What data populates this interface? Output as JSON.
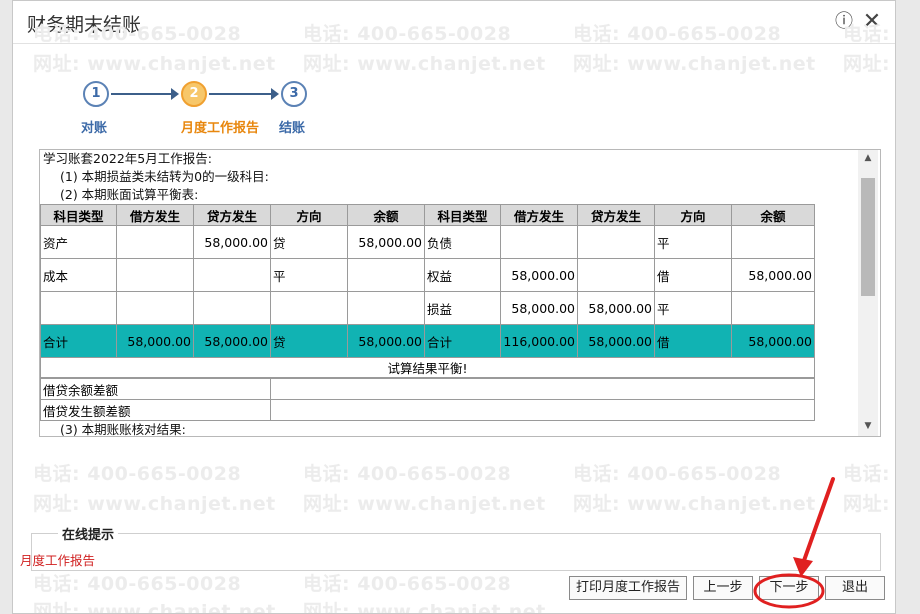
{
  "dialog": {
    "title": "财务期末结账"
  },
  "watermark": {
    "phone": "电话: 400-665-0028",
    "site": "网址: www.chanjet.net"
  },
  "steps": [
    {
      "number": "1",
      "label": "对账",
      "active": false
    },
    {
      "number": "2",
      "label": "月度工作报告",
      "active": true
    },
    {
      "number": "3",
      "label": "结账",
      "active": false
    }
  ],
  "report": {
    "heading": "学习账套2022年5月工作报告:",
    "item1": "(1) 本期损益类未结转为0的一级科目:",
    "item2": "(2) 本期账面试算平衡表:",
    "columns": [
      "科目类型",
      "借方发生",
      "贷方发生",
      "方向",
      "余额",
      "科目类型",
      "借方发生",
      "贷方发生",
      "方向",
      "余额"
    ],
    "rows": [
      [
        "资产",
        "",
        "58,000.00",
        "贷",
        "58,000.00",
        "负债",
        "",
        "",
        "平",
        ""
      ],
      [
        "成本",
        "",
        "",
        "平",
        "",
        "权益",
        "58,000.00",
        "",
        "借",
        "58,000.00"
      ],
      [
        "",
        "",
        "",
        "",
        "",
        "损益",
        "58,000.00",
        "58,000.00",
        "平",
        ""
      ]
    ],
    "total": [
      "合计",
      "58,000.00",
      "58,000.00",
      "贷",
      "58,000.00",
      "合计",
      "116,000.00",
      "58,000.00",
      "借",
      "58,000.00"
    ],
    "balance_result": "试算结果平衡!",
    "diff_rows": [
      "借贷余额差额",
      "借贷发生额差额"
    ],
    "item3": "(3) 本期账账核对结果:"
  },
  "tips": {
    "label": "在线提示",
    "text": "月度工作报告"
  },
  "buttons": {
    "print": "打印月度工作报告",
    "prev": "上一步",
    "next": "下一步",
    "exit": "退出"
  },
  "colors": {
    "total_row": "#11b3b3",
    "active_step": "#f0a030",
    "step": "#3c6aa8",
    "annotation": "#e02020"
  }
}
